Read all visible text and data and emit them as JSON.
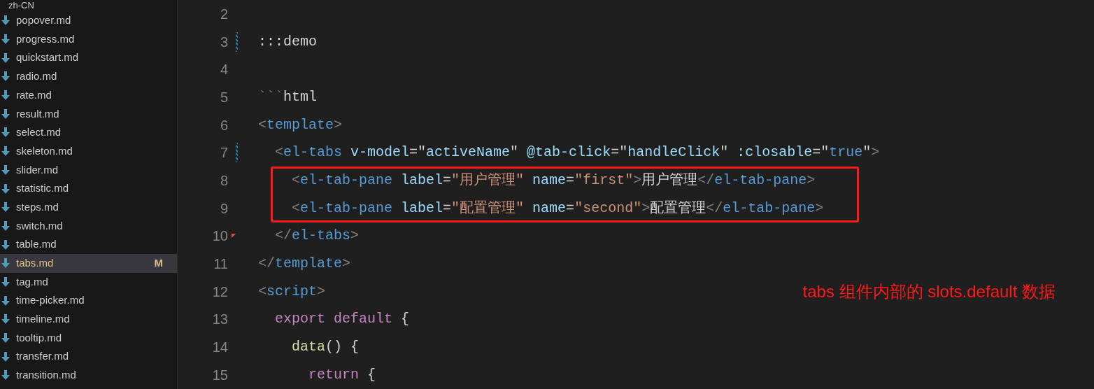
{
  "explorer": {
    "folder": "zh-CN",
    "items": [
      {
        "name": "popover.md",
        "selected": false
      },
      {
        "name": "progress.md",
        "selected": false
      },
      {
        "name": "quickstart.md",
        "selected": false
      },
      {
        "name": "radio.md",
        "selected": false
      },
      {
        "name": "rate.md",
        "selected": false
      },
      {
        "name": "result.md",
        "selected": false
      },
      {
        "name": "select.md",
        "selected": false
      },
      {
        "name": "skeleton.md",
        "selected": false
      },
      {
        "name": "slider.md",
        "selected": false
      },
      {
        "name": "statistic.md",
        "selected": false
      },
      {
        "name": "steps.md",
        "selected": false
      },
      {
        "name": "switch.md",
        "selected": false
      },
      {
        "name": "table.md",
        "selected": false
      },
      {
        "name": "tabs.md",
        "selected": true,
        "badge": "M"
      },
      {
        "name": "tag.md",
        "selected": false
      },
      {
        "name": "time-picker.md",
        "selected": false
      },
      {
        "name": "timeline.md",
        "selected": false
      },
      {
        "name": "tooltip.md",
        "selected": false
      },
      {
        "name": "transfer.md",
        "selected": false
      },
      {
        "name": "transition.md",
        "selected": false
      }
    ]
  },
  "editor": {
    "lines": [
      {
        "number": "2",
        "modified": false,
        "deleted": false,
        "highlighted": false
      },
      {
        "number": "3",
        "modified": true,
        "deleted": false,
        "highlighted": false,
        "tokens": [
          {
            "text": ":::demo",
            "kind": "text"
          }
        ]
      },
      {
        "number": "4",
        "modified": false,
        "deleted": false,
        "highlighted": false
      },
      {
        "number": "5",
        "modified": false,
        "deleted": false,
        "highlighted": false,
        "tokens": [
          {
            "text": "```",
            "kind": "punct"
          },
          {
            "text": "html",
            "kind": "text"
          }
        ]
      },
      {
        "number": "6",
        "modified": false,
        "deleted": false,
        "highlighted": false,
        "tokens": [
          {
            "text": "<",
            "kind": "punct"
          },
          {
            "text": "template",
            "kind": "tag"
          },
          {
            "text": ">",
            "kind": "punct"
          }
        ]
      },
      {
        "number": "7",
        "modified": true,
        "deleted": false,
        "highlighted": false,
        "tokens": [
          {
            "text": "  <",
            "kind": "punct"
          },
          {
            "text": "el-tabs",
            "kind": "tag"
          },
          {
            "text": " v-model",
            "kind": "attr"
          },
          {
            "text": "=\"",
            "kind": "text"
          },
          {
            "text": "activeName",
            "kind": "attr"
          },
          {
            "text": "\" ",
            "kind": "text"
          },
          {
            "text": "@tab-click",
            "kind": "attr"
          },
          {
            "text": "=\"",
            "kind": "text"
          },
          {
            "text": "handleClick",
            "kind": "attr"
          },
          {
            "text": "\" ",
            "kind": "text"
          },
          {
            "text": ":closable",
            "kind": "attr"
          },
          {
            "text": "=\"",
            "kind": "text"
          },
          {
            "text": "true",
            "kind": "tag"
          },
          {
            "text": "\"",
            "kind": "text"
          },
          {
            "text": ">",
            "kind": "punct"
          }
        ]
      },
      {
        "number": "8",
        "modified": false,
        "deleted": false,
        "highlighted": true,
        "tokens": [
          {
            "text": "    <",
            "kind": "punct"
          },
          {
            "text": "el-tab-pane",
            "kind": "tag"
          },
          {
            "text": " label",
            "kind": "attr"
          },
          {
            "text": "=",
            "kind": "text"
          },
          {
            "text": "\"用户管理\"",
            "kind": "string"
          },
          {
            "text": " name",
            "kind": "attr"
          },
          {
            "text": "=",
            "kind": "text"
          },
          {
            "text": "\"first\"",
            "kind": "string"
          },
          {
            "text": ">",
            "kind": "punct"
          },
          {
            "text": "用户管理",
            "kind": "text"
          },
          {
            "text": "</",
            "kind": "punct"
          },
          {
            "text": "el-tab-pane",
            "kind": "tag"
          },
          {
            "text": ">",
            "kind": "punct"
          }
        ]
      },
      {
        "number": "9",
        "modified": false,
        "deleted": false,
        "highlighted": true,
        "tokens": [
          {
            "text": "    <",
            "kind": "punct"
          },
          {
            "text": "el-tab-pane",
            "kind": "tag"
          },
          {
            "text": " label",
            "kind": "attr"
          },
          {
            "text": "=",
            "kind": "text"
          },
          {
            "text": "\"配置管理\"",
            "kind": "string"
          },
          {
            "text": " name",
            "kind": "attr"
          },
          {
            "text": "=",
            "kind": "text"
          },
          {
            "text": "\"second\"",
            "kind": "string"
          },
          {
            "text": ">",
            "kind": "punct"
          },
          {
            "text": "配置管理",
            "kind": "text"
          },
          {
            "text": "</",
            "kind": "punct"
          },
          {
            "text": "el-tab-pane",
            "kind": "tag"
          },
          {
            "text": ">",
            "kind": "punct"
          }
        ]
      },
      {
        "number": "10",
        "modified": false,
        "deleted": true,
        "highlighted": false,
        "tokens": [
          {
            "text": "  </",
            "kind": "punct"
          },
          {
            "text": "el-tabs",
            "kind": "tag"
          },
          {
            "text": ">",
            "kind": "punct"
          }
        ]
      },
      {
        "number": "11",
        "modified": false,
        "deleted": false,
        "highlighted": false,
        "tokens": [
          {
            "text": "</",
            "kind": "punct"
          },
          {
            "text": "template",
            "kind": "tag"
          },
          {
            "text": ">",
            "kind": "punct"
          }
        ]
      },
      {
        "number": "12",
        "modified": false,
        "deleted": false,
        "highlighted": false,
        "note": "tabs 组件内部的 slots.default 数据",
        "tokens": [
          {
            "text": "<",
            "kind": "punct"
          },
          {
            "text": "script",
            "kind": "tag"
          },
          {
            "text": ">",
            "kind": "punct"
          }
        ]
      },
      {
        "number": "13",
        "modified": false,
        "deleted": false,
        "highlighted": false,
        "tokens": [
          {
            "text": "  export default",
            "kind": "keyword"
          },
          {
            "text": " {",
            "kind": "text"
          }
        ]
      },
      {
        "number": "14",
        "modified": false,
        "deleted": false,
        "highlighted": false,
        "tokens": [
          {
            "text": "    data",
            "kind": "func"
          },
          {
            "text": "() {",
            "kind": "text"
          }
        ]
      },
      {
        "number": "15",
        "modified": false,
        "deleted": false,
        "highlighted": false,
        "tokens": [
          {
            "text": "      return",
            "kind": "keyword"
          },
          {
            "text": " {",
            "kind": "text"
          }
        ]
      }
    ]
  }
}
